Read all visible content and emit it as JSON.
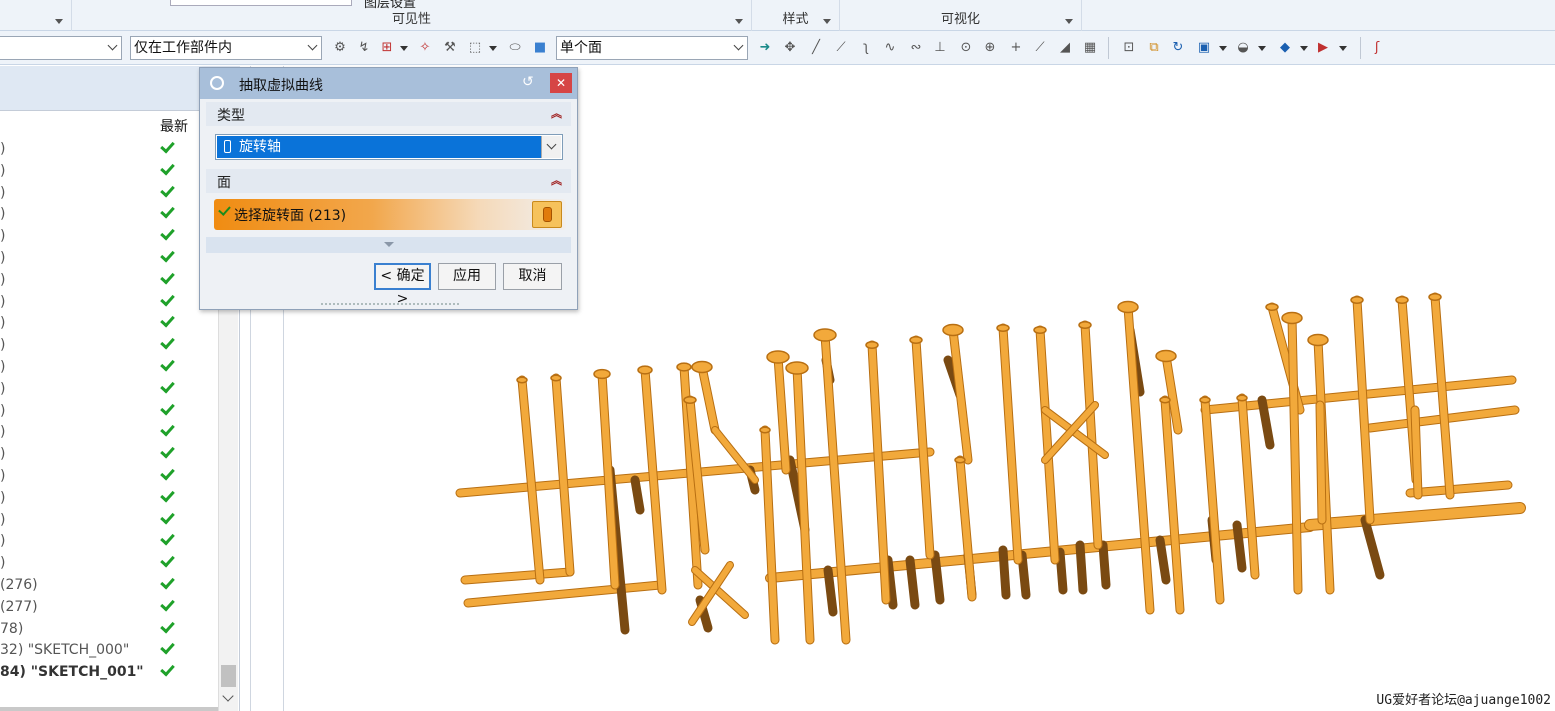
{
  "ribbon": {
    "top_text": "图层设置",
    "groups": [
      {
        "label": ""
      },
      {
        "label": "可见性"
      },
      {
        "label": "样式"
      },
      {
        "label": "可视化"
      }
    ]
  },
  "toolbar": {
    "filter_combo": "",
    "scope_combo": "仅在工作部件内",
    "face_rule_combo": "单个面"
  },
  "navigator": {
    "column_latest": "最新",
    "rows": [
      {
        "text": ")"
      },
      {
        "text": ")"
      },
      {
        "text": ")"
      },
      {
        "text": ")"
      },
      {
        "text": ")"
      },
      {
        "text": ")"
      },
      {
        "text": ")"
      },
      {
        "text": ")"
      },
      {
        "text": ")"
      },
      {
        "text": ")"
      },
      {
        "text": ")"
      },
      {
        "text": ")"
      },
      {
        "text": ")"
      },
      {
        "text": ")"
      },
      {
        "text": ")"
      },
      {
        "text": ")"
      },
      {
        "text": ")"
      },
      {
        "text": ")"
      },
      {
        "text": ")"
      },
      {
        "text": ")"
      },
      {
        "text": "(276)"
      },
      {
        "text": "(277)"
      },
      {
        "text": "78)"
      },
      {
        "text": "32) \"SKETCH_000\""
      },
      {
        "text": "84) \"SKETCH_001\""
      }
    ]
  },
  "dialog": {
    "title": "抽取虚拟曲线",
    "section_type": "类型",
    "type_value": "旋转轴",
    "section_face": "面",
    "face_select_label": "选择旋转面 (213)",
    "ok_label": "< 确定 >",
    "apply_label": "应用",
    "cancel_label": "取消"
  },
  "viewport": {
    "watermark": "UG爱好者论坛@ajuange1002"
  },
  "colors": {
    "pipe": "#f2a93b",
    "pipe_dark": "#b86f12",
    "accent": "#0a73d9",
    "check": "#1fa12a"
  }
}
